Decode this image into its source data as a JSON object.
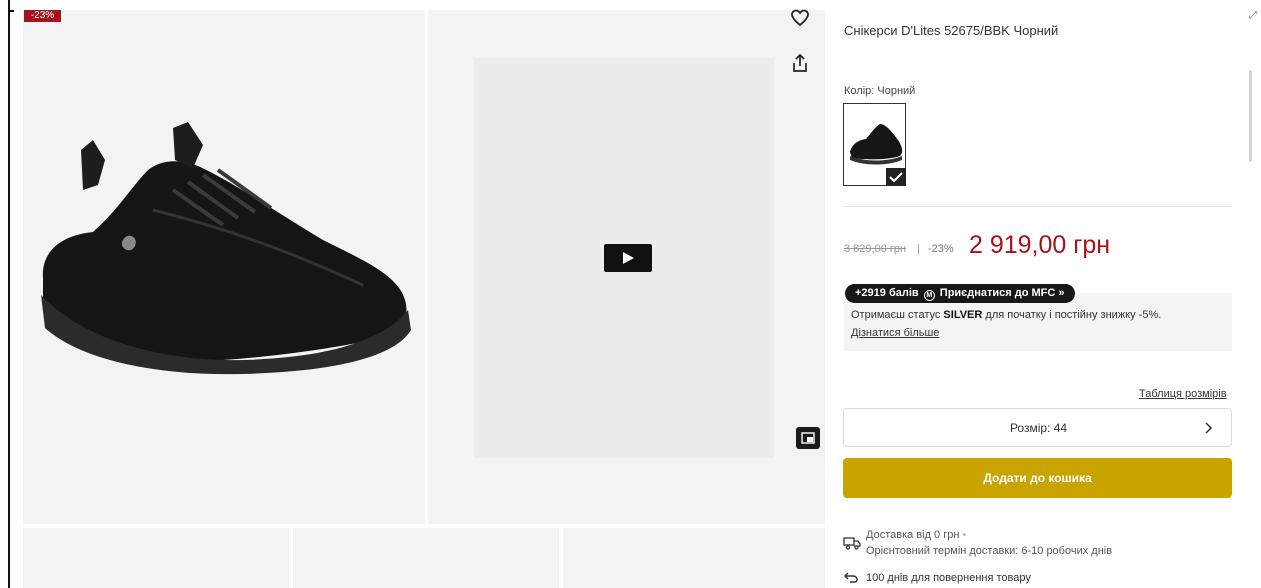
{
  "gallery": {
    "discount_badge": "-23%",
    "images": [
      "shoe-side-view",
      "model-wearing-shoes-video"
    ]
  },
  "product": {
    "title": "Снікерси D'Lites 52675/BBK Чорний",
    "color_label": "Колір: Чорний",
    "old_price": "3 829,00 грн",
    "separator": "|",
    "discount": "-23%",
    "price": "2 919,00 грн"
  },
  "loyalty": {
    "pill_prefix": "+2919 балів",
    "pill_logo": "M",
    "pill_suffix": "Приєднатися до MFC »",
    "text_prefix": "Отримаєш статус ",
    "text_bold": "SILVER",
    "text_suffix": " для початку і постійну знижку -5%.",
    "link": "Дізнатися більше"
  },
  "size": {
    "table_link": "Таблиця розмірів",
    "label": "Розмір: 44"
  },
  "cart": {
    "add_label": "Додати до кошика"
  },
  "delivery": {
    "line1": "Доставка від 0 грн",
    "line1_dot": "•",
    "line2": "Орієнтовний термін доставки: 6-10 робочих днів"
  },
  "returns": {
    "text": "100 днів для повернення товару"
  },
  "colors": {
    "accent_red": "#a3131a",
    "cart_gold": "#c9a400"
  }
}
